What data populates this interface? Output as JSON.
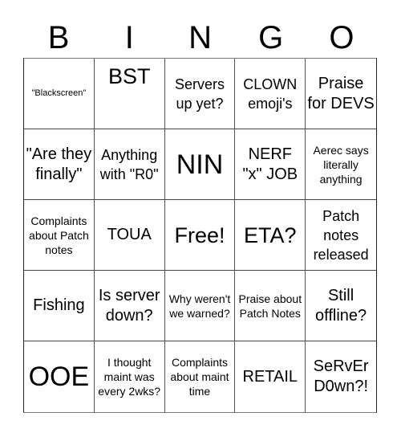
{
  "header": [
    "B",
    "I",
    "N",
    "G",
    "O"
  ],
  "cells": [
    {
      "text": "\"Blackscreen\"",
      "size": "s-xs"
    },
    {
      "text": "BST",
      "size": "s-xl",
      "align": "top"
    },
    {
      "text": "Servers up yet?",
      "size": "s-m"
    },
    {
      "text": "CLOWN emoji's",
      "size": "s-m"
    },
    {
      "text": "Praise for DEVS",
      "size": "s-l"
    },
    {
      "text": "\"Are they finally\"",
      "size": "s-l"
    },
    {
      "text": "Anything with \"R0\"",
      "size": "s-m"
    },
    {
      "text": "NIN",
      "size": "s-xxl"
    },
    {
      "text": "NERF \"x\" JOB",
      "size": "s-l"
    },
    {
      "text": "Aerec says literally anything",
      "size": "s-s"
    },
    {
      "text": "Complaints about Patch notes",
      "size": "s-s"
    },
    {
      "text": "TOUA",
      "size": "s-l"
    },
    {
      "text": "Free!",
      "size": "s-xl"
    },
    {
      "text": "ETA?",
      "size": "s-xl"
    },
    {
      "text": "Patch notes released",
      "size": "s-m"
    },
    {
      "text": "Fishing",
      "size": "s-l"
    },
    {
      "text": "Is server down?",
      "size": "s-l"
    },
    {
      "text": "Why weren't we warned?",
      "size": "s-s"
    },
    {
      "text": "Praise about Patch Notes",
      "size": "s-s"
    },
    {
      "text": "Still offline?",
      "size": "s-l"
    },
    {
      "text": "OOE",
      "size": "s-xxl"
    },
    {
      "text": "I thought maint was every 2wks?",
      "size": "s-s"
    },
    {
      "text": "Complaints about maint time",
      "size": "s-s"
    },
    {
      "text": "RETAIL",
      "size": "s-l"
    },
    {
      "text": "SeRvEr D0wn?!",
      "size": "s-l"
    }
  ]
}
